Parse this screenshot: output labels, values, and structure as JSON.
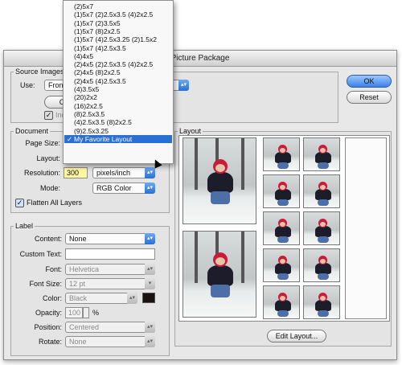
{
  "window": {
    "title": "Picture Package"
  },
  "source": {
    "group_label": "Source Images",
    "use_label": "Use:",
    "use_value": "Front",
    "choose_label": "Cho",
    "include_label": "Inc"
  },
  "buttons": {
    "ok": "OK",
    "reset": "Reset",
    "edit_layout": "Edit Layout..."
  },
  "document": {
    "group_label": "Document",
    "page_size_label": "Page Size:",
    "layout_label": "Layout:",
    "resolution_label": "Resolution:",
    "resolution_value": "300",
    "resolution_unit": "pixels/inch",
    "mode_label": "Mode:",
    "mode_value": "RGB Color",
    "flatten_label": "Flatten All Layers"
  },
  "layout_menu": {
    "items": [
      "(2)5x7",
      "(1)5x7 (2)2.5x3.5 (4)2x2.5",
      "(1)5x7 (2)3.5x5",
      "(1)5x7 (8)2x2.5",
      "(1)5x7 (4)2.5x3.25 (2)1.5x2",
      "(1)5x7 (4)2.5x3.5",
      "(4)4x5",
      "(2)4x5 (2)2.5x3.5 (4)2x2.5",
      "(2)4x5 (8)2x2.5",
      "(2)4x5 (4)2.5x3.5",
      "(4)3.5x5",
      "(20)2x2",
      "(16)2x2.5",
      "(8)2.5x3.5",
      "(4)2.5x3.5 (8)2x2.5",
      "(9)2.5x3.25",
      "My Favorite Layout"
    ],
    "selected_index": 16,
    "check": "✓"
  },
  "label_group": {
    "group_label": "Label",
    "content_label": "Content:",
    "content_value": "None",
    "custom_text_label": "Custom Text:",
    "font_label": "Font:",
    "font_value": "Helvetica",
    "font_size_label": "Font Size:",
    "font_size_value": "12 pt",
    "color_label": "Color:",
    "color_value": "Black",
    "opacity_label": "Opacity:",
    "opacity_value": "100",
    "opacity_unit": "%",
    "position_label": "Position:",
    "position_value": "Centered",
    "rotate_label": "Rotate:",
    "rotate_value": "None"
  },
  "preview": {
    "group_label": "Layout"
  },
  "colors": {
    "accent": "#2a6fd3",
    "resolution_field": "#fff7a0",
    "swatch": "#1a1212"
  },
  "icons": {
    "popup": "double-chevron-icon",
    "cursor": "pointer-cursor-icon"
  }
}
